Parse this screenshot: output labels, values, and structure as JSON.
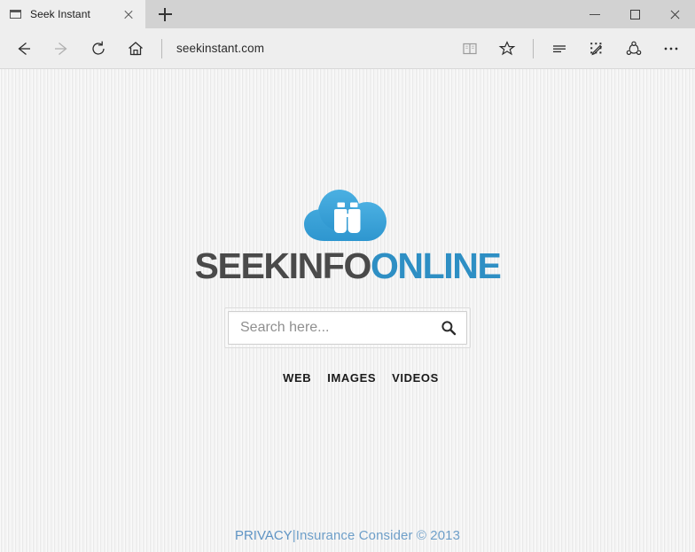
{
  "browser": {
    "tab": {
      "title": "Seek Instant",
      "favicon_icon": "window-icon",
      "close_icon": "close-icon"
    },
    "new_tab_icon": "plus-icon",
    "window_controls": {
      "minimize_icon": "minimize-icon",
      "maximize_icon": "maximize-icon",
      "close_icon": "close-icon"
    },
    "nav": {
      "back_icon": "arrow-left-icon",
      "forward_icon": "arrow-right-icon",
      "refresh_icon": "refresh-icon",
      "home_icon": "home-icon",
      "url": "seekinstant.com"
    },
    "toolbar": {
      "reading_view_icon": "book-icon",
      "favorites_icon": "star-icon",
      "hub_icon": "hub-lines-icon",
      "web_notes_icon": "pencil-note-icon",
      "share_icon": "share-icon",
      "settings_icon": "ellipsis-icon"
    }
  },
  "page": {
    "logo": {
      "icon": "cloud-binoculars-logo",
      "cloud_color": "#3aa0d8",
      "glyph_color": "#ffffff"
    },
    "wordmark": {
      "part1": "SEEKINFO",
      "part2": "ONLINE",
      "part1_color": "#4a4a4a",
      "part2_color": "#2e8fc4"
    },
    "search": {
      "placeholder": "Search here...",
      "value": "",
      "button_icon": "search-icon"
    },
    "nav_links": [
      {
        "label": "WEB"
      },
      {
        "label": "IMAGES"
      },
      {
        "label": "VIDEOS"
      }
    ],
    "footer": {
      "privacy_label": "PRIVACY",
      "separator": " | ",
      "copyright": "Insurance Consider © 2013",
      "color": "#6e9fc9"
    }
  }
}
